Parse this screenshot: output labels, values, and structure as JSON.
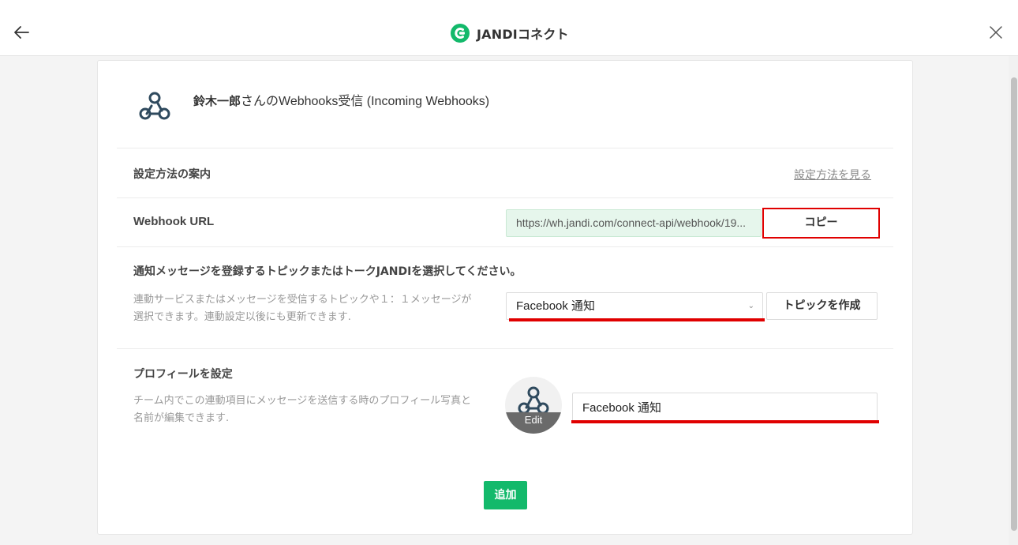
{
  "topbar": {
    "title": "JANDIコネクト",
    "back_icon": "arrow-left-icon",
    "close_icon": "close-icon",
    "brand_color": "#13b96b"
  },
  "header": {
    "user_name": "鈴木一郎",
    "title_suffix": "さんのWebhooks受信 (Incoming Webhooks)",
    "icon": "webhook-icon"
  },
  "guide": {
    "label": "設定方法の案内",
    "link": "設定方法を見る"
  },
  "webhook": {
    "label": "Webhook URL",
    "url": "https://wh.jandi.com/connect-api/webhook/19...",
    "copy_label": "コピー"
  },
  "topic": {
    "label": "通知メッセージを登録するトピックまたはトークJANDIを選択してください。",
    "help": "連動サービスまたはメッセージを受信するトピックや１：１メッセージが選択できます。連動設定以後にも更新できます.",
    "selected": "Facebook 通知",
    "create_label": "トピックを作成"
  },
  "profile": {
    "label": "プロフィールを設定",
    "help": "チーム内でこの連動項目にメッセージを送信する時のプロフィール写真と名前が編集できます.",
    "edit_label": "Edit",
    "name_value": "Facebook 通知"
  },
  "actions": {
    "add_label": "追加"
  },
  "colors": {
    "highlight": "#e00000",
    "primary": "#13b96b",
    "url_bg": "#e6f6ec",
    "icon": "#2f4a5e"
  }
}
